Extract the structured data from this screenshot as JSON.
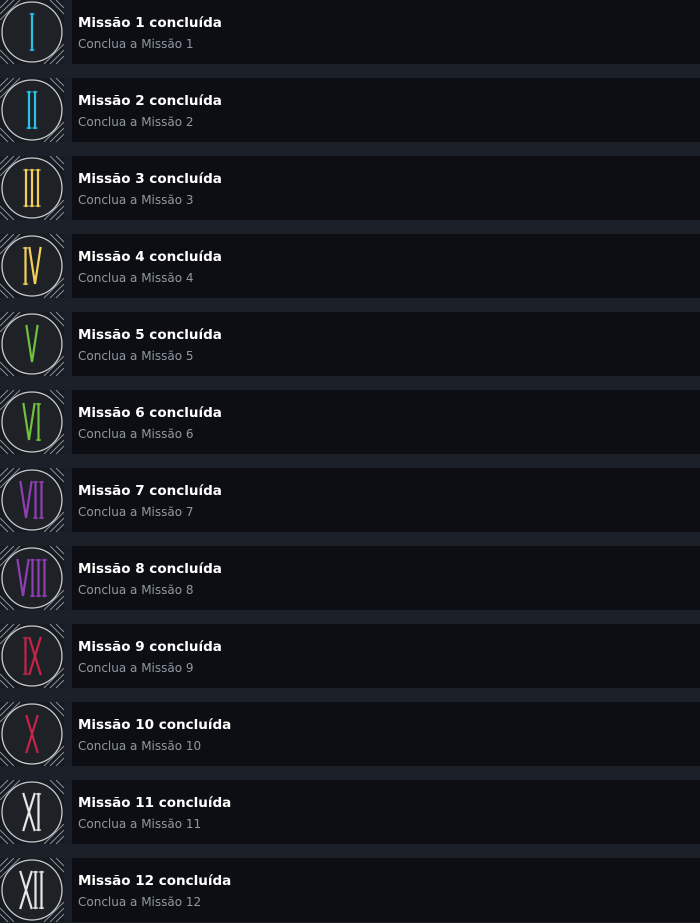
{
  "achievements": [
    {
      "title": "Missão 1 concluída",
      "description": "Conclua a Missão 1",
      "numeral": "I",
      "color": "#2ac3e8",
      "icon": "roman-numeral-1-icon"
    },
    {
      "title": "Missão 2 concluída",
      "description": "Conclua a Missão 2",
      "numeral": "II",
      "color": "#2ac3e8",
      "icon": "roman-numeral-2-icon"
    },
    {
      "title": "Missão 3 concluída",
      "description": "Conclua a Missão 3",
      "numeral": "III",
      "color": "#f3cf5a",
      "icon": "roman-numeral-3-icon"
    },
    {
      "title": "Missão 4 concluída",
      "description": "Conclua a Missão 4",
      "numeral": "IV",
      "color": "#f3cf5a",
      "icon": "roman-numeral-4-icon"
    },
    {
      "title": "Missão 5 concluída",
      "description": "Conclua a Missão 5",
      "numeral": "V",
      "color": "#6fc13e",
      "icon": "roman-numeral-5-icon"
    },
    {
      "title": "Missão 6 concluída",
      "description": "Conclua a Missão 6",
      "numeral": "VI",
      "color": "#6fc13e",
      "icon": "roman-numeral-6-icon"
    },
    {
      "title": "Missão 7 concluída",
      "description": "Conclua a Missão 7",
      "numeral": "VII",
      "color": "#8f3fb3",
      "icon": "roman-numeral-7-icon"
    },
    {
      "title": "Missão 8 concluída",
      "description": "Conclua a Missão 8",
      "numeral": "VIII",
      "color": "#8f3fb3",
      "icon": "roman-numeral-8-icon"
    },
    {
      "title": "Missão 9 concluída",
      "description": "Conclua a Missão 9",
      "numeral": "IX",
      "color": "#c4244a",
      "icon": "roman-numeral-9-icon"
    },
    {
      "title": "Missão 10 concluída",
      "description": "Conclua a Missão 10",
      "numeral": "X",
      "color": "#c4244a",
      "icon": "roman-numeral-10-icon"
    },
    {
      "title": "Missão 11 concluída",
      "description": "Conclua a Missão 11",
      "numeral": "XI",
      "color": "#e6e6e6",
      "icon": "roman-numeral-11-icon"
    },
    {
      "title": "Missão 12 concluída",
      "description": "Conclua a Missão 12",
      "numeral": "XII",
      "color": "#e6e6e6",
      "icon": "roman-numeral-12-icon"
    }
  ]
}
